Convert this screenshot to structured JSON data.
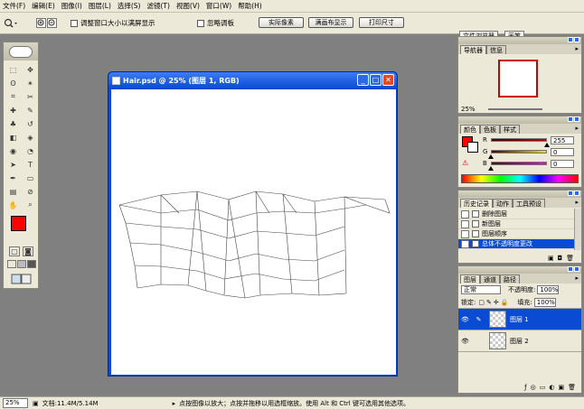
{
  "menu": [
    "文件(F)",
    "编辑(E)",
    "图像(I)",
    "图层(L)",
    "选择(S)",
    "滤镜(T)",
    "视图(V)",
    "窗口(W)",
    "帮助(H)"
  ],
  "options": {
    "resize_window_label": "调整窗口大小以满屏显示",
    "ignore_palettes_label": "忽略调板",
    "actual_pixels": "实际像素",
    "fit_screen": "满画布显示",
    "print_size": "打印尺寸"
  },
  "tab_well": [
    "文件浏览器",
    "画笔"
  ],
  "document": {
    "title": "Hair.psd @ 25% (图层 1, RGB)"
  },
  "navigator": {
    "tabs": [
      "导航器",
      "信息"
    ],
    "zoom": "25%"
  },
  "color": {
    "tabs": [
      "颜色",
      "色板",
      "样式"
    ],
    "channels": [
      {
        "label": "R",
        "value": "255",
        "level": 1.0,
        "track": "#c00000"
      },
      {
        "label": "G",
        "value": "0",
        "level": 0.0,
        "track": "#e6e600"
      },
      {
        "label": "B",
        "value": "0",
        "level": 0.0,
        "track": "#e000e0"
      }
    ],
    "foreground": "#ff0000",
    "background": "#ffffff"
  },
  "history": {
    "tabs": [
      "历史记录",
      "动作",
      "工具预设"
    ],
    "items": [
      {
        "label": "删除图层",
        "selected": false
      },
      {
        "label": "新图层",
        "selected": false
      },
      {
        "label": "图层顺序",
        "selected": false
      },
      {
        "label": "总体不透明度更改",
        "selected": true
      }
    ]
  },
  "layers": {
    "tabs": [
      "图层",
      "通道",
      "路径"
    ],
    "blend_mode": "正常",
    "opacity_label": "不透明度:",
    "opacity_value": "100%",
    "lock_label": "锁定:",
    "fill_label": "填充:",
    "fill_value": "100%",
    "items": [
      {
        "name": "图层 1",
        "selected": true
      },
      {
        "name": "图层 2",
        "selected": false
      }
    ]
  },
  "status": {
    "zoom": "25%",
    "doc_size": "文档:11.4M/5.14M",
    "hint": "点按图像以放大；点按并拖移以用选框缩放。使用 Alt 和 Ctrl 键可选用其他选项。"
  }
}
